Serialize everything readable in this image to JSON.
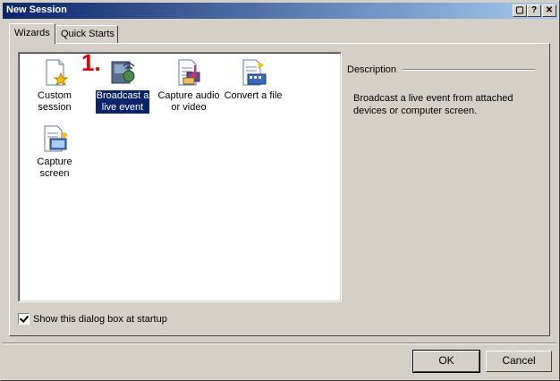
{
  "window": {
    "title": "New Session",
    "controls": [
      "restore-icon",
      "help-icon",
      "close-icon"
    ],
    "control_glyphs": {
      "restore": "▢",
      "help": "?",
      "close": "✕"
    }
  },
  "tabs": [
    {
      "label": "Wizards",
      "active": true
    },
    {
      "label": "Quick Starts",
      "active": false
    }
  ],
  "wizards": [
    {
      "label_line1": "Custom",
      "label_line2": "session",
      "icon": "custom-session-icon",
      "selected": false
    },
    {
      "label_line1": "Broadcast a",
      "label_line2": "live event",
      "icon": "broadcast-icon",
      "selected": true
    },
    {
      "label_line1": "Capture audio",
      "label_line2": "or video",
      "icon": "capture-av-icon",
      "selected": false
    },
    {
      "label_line1": "Convert a file",
      "label_line2": "",
      "icon": "convert-file-icon",
      "selected": false
    },
    {
      "label_line1": "Capture",
      "label_line2": "screen",
      "icon": "capture-screen-icon",
      "selected": false
    }
  ],
  "step_marker": "1.",
  "description": {
    "title": "Description",
    "text": "Broadcast a live event from attached devices or computer screen."
  },
  "startup_checkbox": {
    "label": "Show this dialog box at startup",
    "checked": true
  },
  "buttons": {
    "ok": "OK",
    "cancel": "Cancel"
  },
  "colors": {
    "title_start": "#0a246a",
    "title_end": "#a6caf0",
    "selection": "#0a246a",
    "marker": "#e00000"
  }
}
